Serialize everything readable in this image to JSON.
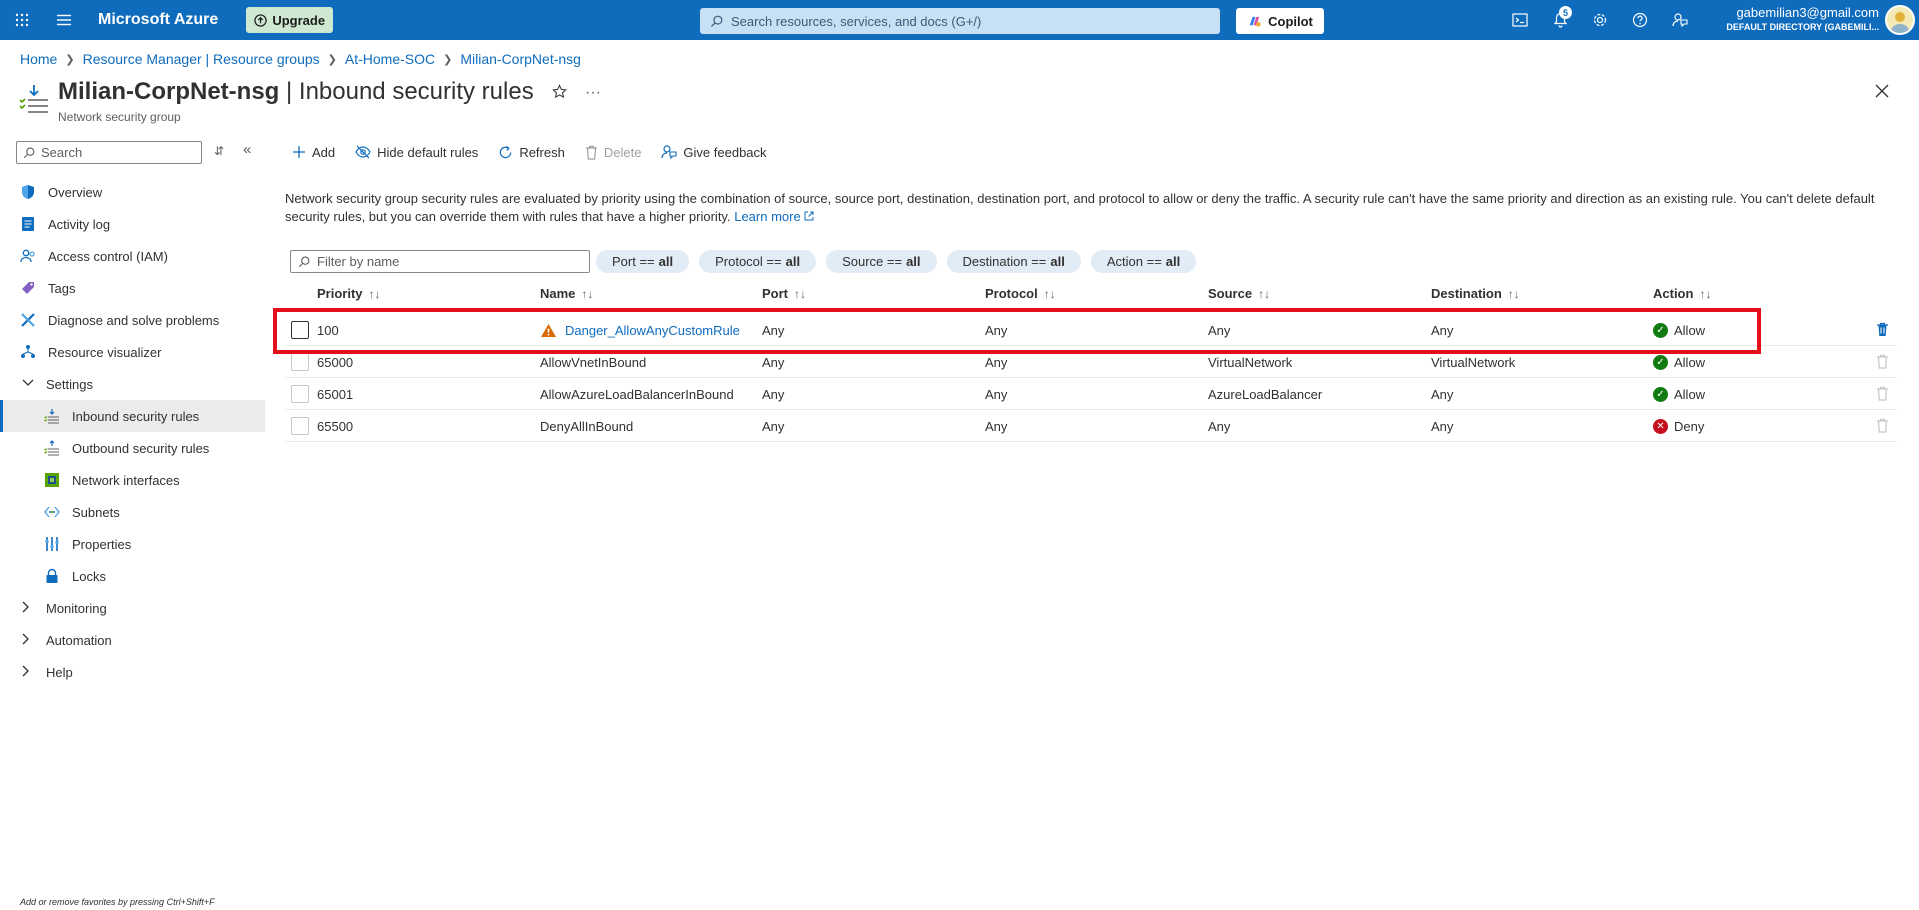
{
  "topbar": {
    "brand": "Microsoft Azure",
    "upgrade_label": "Upgrade",
    "search_placeholder": "Search resources, services, and docs (G+/)",
    "copilot_label": "Copilot",
    "notification_count": "5",
    "account_email": "gabemilian3@gmail.com",
    "account_directory": "DEFAULT DIRECTORY (GABEMILI..."
  },
  "breadcrumb": [
    "Home",
    "Resource Manager | Resource groups",
    "At-Home-SOC",
    "Milian-CorpNet-nsg"
  ],
  "header": {
    "resource_name": "Milian-CorpNet-nsg",
    "page_name": " | Inbound security rules",
    "subtitle": "Network security group"
  },
  "sidebar": {
    "search_placeholder": "Search",
    "items": [
      {
        "label": "Overview"
      },
      {
        "label": "Activity log"
      },
      {
        "label": "Access control (IAM)"
      },
      {
        "label": "Tags"
      },
      {
        "label": "Diagnose and solve problems"
      },
      {
        "label": "Resource visualizer"
      },
      {
        "label": "Settings"
      },
      {
        "label": "Inbound security rules"
      },
      {
        "label": "Outbound security rules"
      },
      {
        "label": "Network interfaces"
      },
      {
        "label": "Subnets"
      },
      {
        "label": "Properties"
      },
      {
        "label": "Locks"
      },
      {
        "label": "Monitoring"
      },
      {
        "label": "Automation"
      },
      {
        "label": "Help"
      }
    ],
    "footer": "Add or remove favorites by pressing Ctrl+Shift+F"
  },
  "toolbar": {
    "add": "Add",
    "hide_default": "Hide default rules",
    "refresh": "Refresh",
    "delete": "Delete",
    "feedback": "Give feedback"
  },
  "description": {
    "text": "Network security group security rules are evaluated by priority using the combination of source, source port, destination, destination port, and protocol to allow or deny the traffic. A security rule can't have the same priority and direction as an existing rule. You can't delete default security rules, but you can override them with rules that have a higher priority.",
    "link": "Learn more"
  },
  "filters": {
    "name_placeholder": "Filter by name",
    "pills": [
      {
        "key": "Port ==",
        "value": "all"
      },
      {
        "key": "Protocol ==",
        "value": "all"
      },
      {
        "key": "Source ==",
        "value": "all"
      },
      {
        "key": "Destination ==",
        "value": "all"
      },
      {
        "key": "Action ==",
        "value": "all"
      }
    ]
  },
  "table": {
    "columns": [
      "Priority",
      "Name",
      "Port",
      "Protocol",
      "Source",
      "Destination",
      "Action"
    ],
    "rows": [
      {
        "priority": "100",
        "name": "Danger_AllowAnyCustomRule",
        "port": "Any",
        "protocol": "Any",
        "source": "Any",
        "destination": "Any",
        "action": "Allow"
      },
      {
        "priority": "65000",
        "name": "AllowVnetInBound",
        "port": "Any",
        "protocol": "Any",
        "source": "VirtualNetwork",
        "destination": "VirtualNetwork",
        "action": "Allow"
      },
      {
        "priority": "65001",
        "name": "AllowAzureLoadBalancerInBound",
        "port": "Any",
        "protocol": "Any",
        "source": "AzureLoadBalancer",
        "destination": "Any",
        "action": "Allow"
      },
      {
        "priority": "65500",
        "name": "DenyAllInBound",
        "port": "Any",
        "protocol": "Any",
        "source": "Any",
        "destination": "Any",
        "action": "Deny"
      }
    ]
  },
  "colors": {
    "accent": "#0f6cbd",
    "allow": "#107c10",
    "deny": "#c50f1f",
    "warning": "#d86c00",
    "highlight": "#e3101c"
  }
}
